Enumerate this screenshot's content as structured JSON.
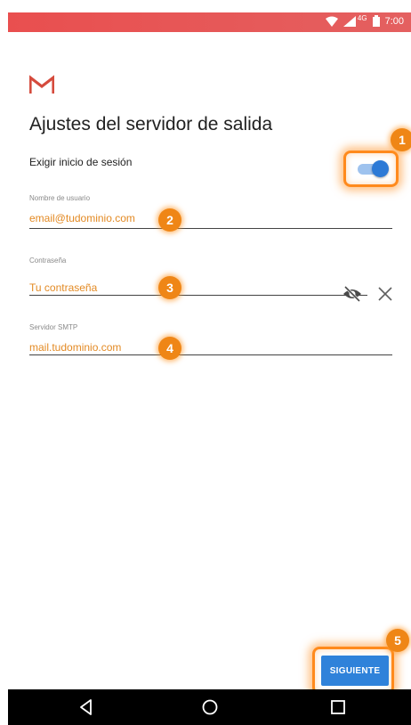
{
  "status_bar": {
    "network": "4G",
    "time": "7:00"
  },
  "header": {
    "logo_icon": "gmail-m-icon",
    "title": "Ajustes del servidor de salida"
  },
  "login_toggle": {
    "label": "Exigir inicio de sesión",
    "enabled": true
  },
  "fields": {
    "username": {
      "label": "Nombre de usuario",
      "value": "email@tudominio.com"
    },
    "password": {
      "label": "Contraseña",
      "value": "Tu contraseña"
    },
    "smtp": {
      "label": "Servidor SMTP",
      "value": "mail.tudominio.com"
    }
  },
  "badges": [
    "1",
    "2",
    "3",
    "4",
    "5"
  ],
  "next_button": {
    "label": "SIGUIENTE"
  },
  "nav_bar": {
    "icons": [
      "back-icon",
      "home-icon",
      "recents-icon"
    ]
  },
  "colors": {
    "status_bar": "#e15a5a",
    "accent": "#2f82da",
    "value_text": "#e38a24",
    "badge": "#ef8616"
  }
}
